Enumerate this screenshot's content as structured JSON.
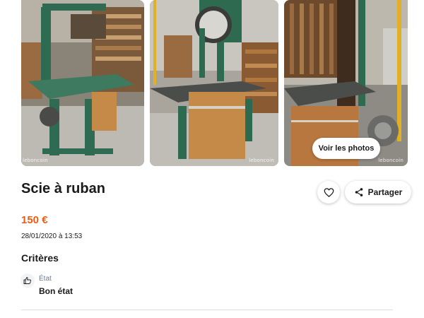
{
  "gallery": {
    "photos": [
      {
        "name": "band-saw-photo-1",
        "watermark": "leboncoin"
      },
      {
        "name": "band-saw-photo-2",
        "watermark": "leboncoin"
      },
      {
        "name": "band-saw-photo-3",
        "watermark": "leboncoin"
      }
    ],
    "view_photos_label": "Voir les photos"
  },
  "listing": {
    "title": "Scie à ruban",
    "price": "150 €",
    "date": "28/01/2020 à 13:53"
  },
  "actions": {
    "favorite_icon": "heart-icon",
    "share_icon": "share-icon",
    "share_label": "Partager"
  },
  "criteria": {
    "heading": "Critères",
    "items": [
      {
        "icon": "thumbs-up-icon",
        "label": "État",
        "value": "Bon état"
      }
    ]
  },
  "colors": {
    "price": "#ec5a13",
    "text": "#1a1a1a",
    "muted": "#6b7a8f"
  }
}
